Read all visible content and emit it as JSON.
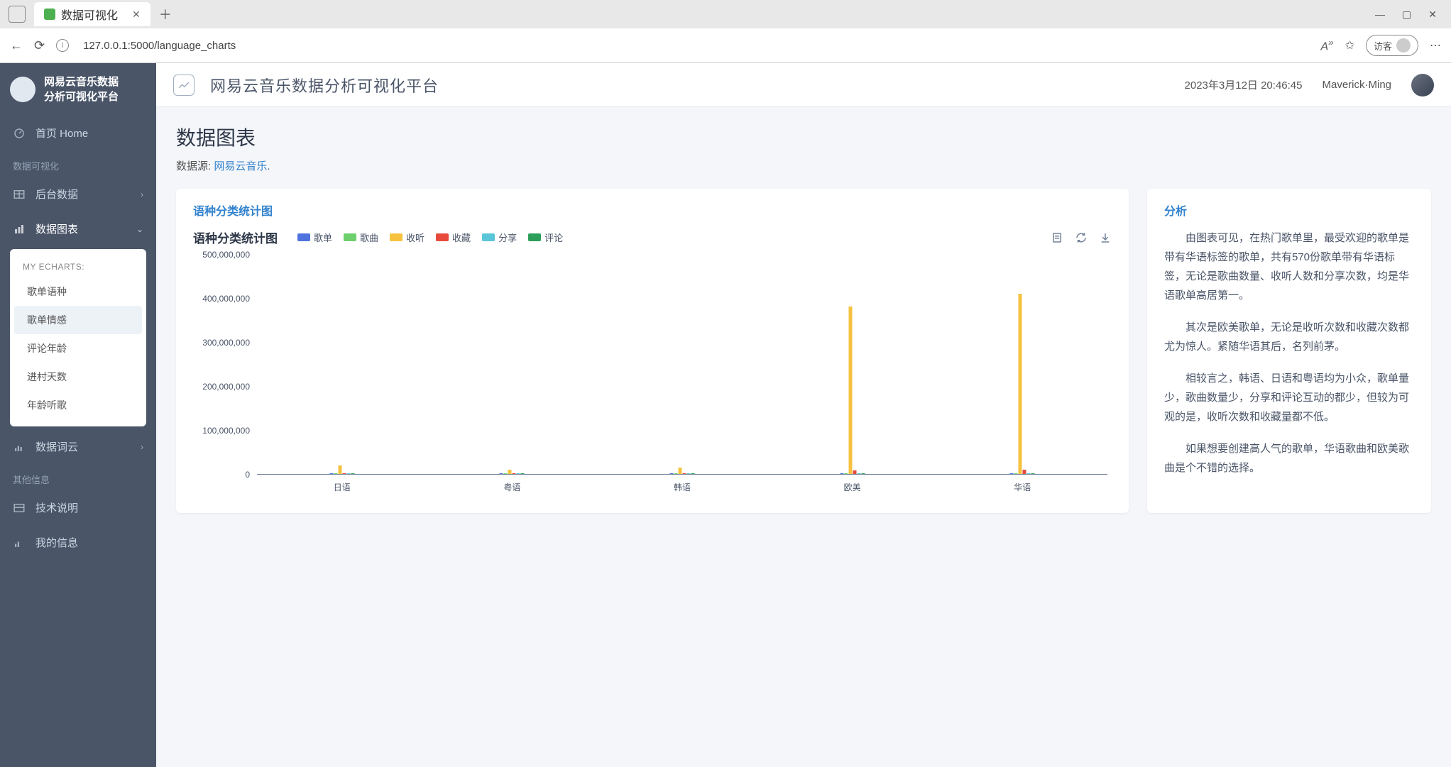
{
  "browser": {
    "tab_title": "数据可视化",
    "url": "127.0.0.1:5000/language_charts",
    "guest_label": "访客"
  },
  "brand": {
    "line1": "网易云音乐数据",
    "line2": "分析可视化平台"
  },
  "sidebar": {
    "home": "首页 Home",
    "section_viz": "数据可视化",
    "backend": "后台数据",
    "charts": "数据图表",
    "submenu_title": "MY ECHARTS:",
    "submenu": [
      "歌单语种",
      "歌单情感",
      "评论年龄",
      "进村天数",
      "年龄听歌"
    ],
    "wordcloud": "数据词云",
    "section_other": "其他信息",
    "tech": "技术说明",
    "myinfo": "我的信息"
  },
  "topbar": {
    "title": "网易云音乐数据分析可视化平台",
    "datetime": "2023年3月12日 20:46:45",
    "username": "Maverick·Ming"
  },
  "page": {
    "title": "数据图表",
    "sub_prefix": "数据源: ",
    "sub_link": "网易云音乐",
    "sub_suffix": "."
  },
  "chart_card_title": "语种分类统计图",
  "analysis": {
    "title": "分析",
    "paragraphs": [
      "由图表可见，在热门歌单里，最受欢迎的歌单是带有华语标签的歌单，共有570份歌单带有华语标签，无论是歌曲数量、收听人数和分享次数，均是华语歌单高居第一。",
      "其次是欧美歌单，无论是收听次数和收藏次数都尤为惊人。紧随华语其后，名列前茅。",
      "相较言之，韩语、日语和粤语均为小众，歌单量少，歌曲数量少，分享和评论互动的都少，但较为可观的是，收听次数和收藏量都不低。",
      "如果想要创建高人气的歌单，华语歌曲和欧美歌曲是个不错的选择。"
    ]
  },
  "chart_data": {
    "type": "bar",
    "title": "语种分类统计图",
    "ylabel": "",
    "xlabel": "",
    "ylim": [
      0,
      500000000
    ],
    "yticks": [
      0,
      100000000,
      200000000,
      300000000,
      400000000,
      500000000
    ],
    "categories": [
      "日语",
      "粤语",
      "韩语",
      "欧美",
      "华语"
    ],
    "series": [
      {
        "name": "歌单",
        "color": "#4e73df",
        "values": [
          150,
          80,
          120,
          420,
          570
        ]
      },
      {
        "name": "歌曲",
        "color": "#6dd06d",
        "values": [
          8000,
          4000,
          6000,
          22000,
          30000
        ]
      },
      {
        "name": "收听",
        "color": "#f6c23e",
        "values": [
          20000000,
          10000000,
          15000000,
          380000000,
          410000000
        ]
      },
      {
        "name": "收藏",
        "color": "#e74a3b",
        "values": [
          1500000,
          800000,
          1200000,
          8000000,
          9000000
        ]
      },
      {
        "name": "分享",
        "color": "#5bc5d9",
        "values": [
          60000,
          30000,
          50000,
          400000,
          600000
        ]
      },
      {
        "name": "评论",
        "color": "#2e9e5b",
        "values": [
          100000,
          50000,
          80000,
          700000,
          900000
        ]
      }
    ]
  }
}
